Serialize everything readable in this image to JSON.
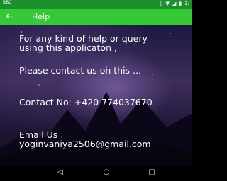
{
  "status_bar": {
    "left_badge": "BBC",
    "time": "3:"
  },
  "app_bar": {
    "title": "Help",
    "back_icon": "arrow-left-icon"
  },
  "content": {
    "line1": "For any kind of help or query\nusing this applicaton ,",
    "line2": "Please contact us on this ...",
    "line3": "Contact No: +420 774037670",
    "line4": "Email Us :\nyoginvaniya2506@gmail.com"
  },
  "nav_bar": {
    "back": "◁",
    "home": "○",
    "recent": "□"
  },
  "colors": {
    "status_bar": "#1b8f2e",
    "app_bar": "#35c935",
    "text": "#ffffff"
  }
}
